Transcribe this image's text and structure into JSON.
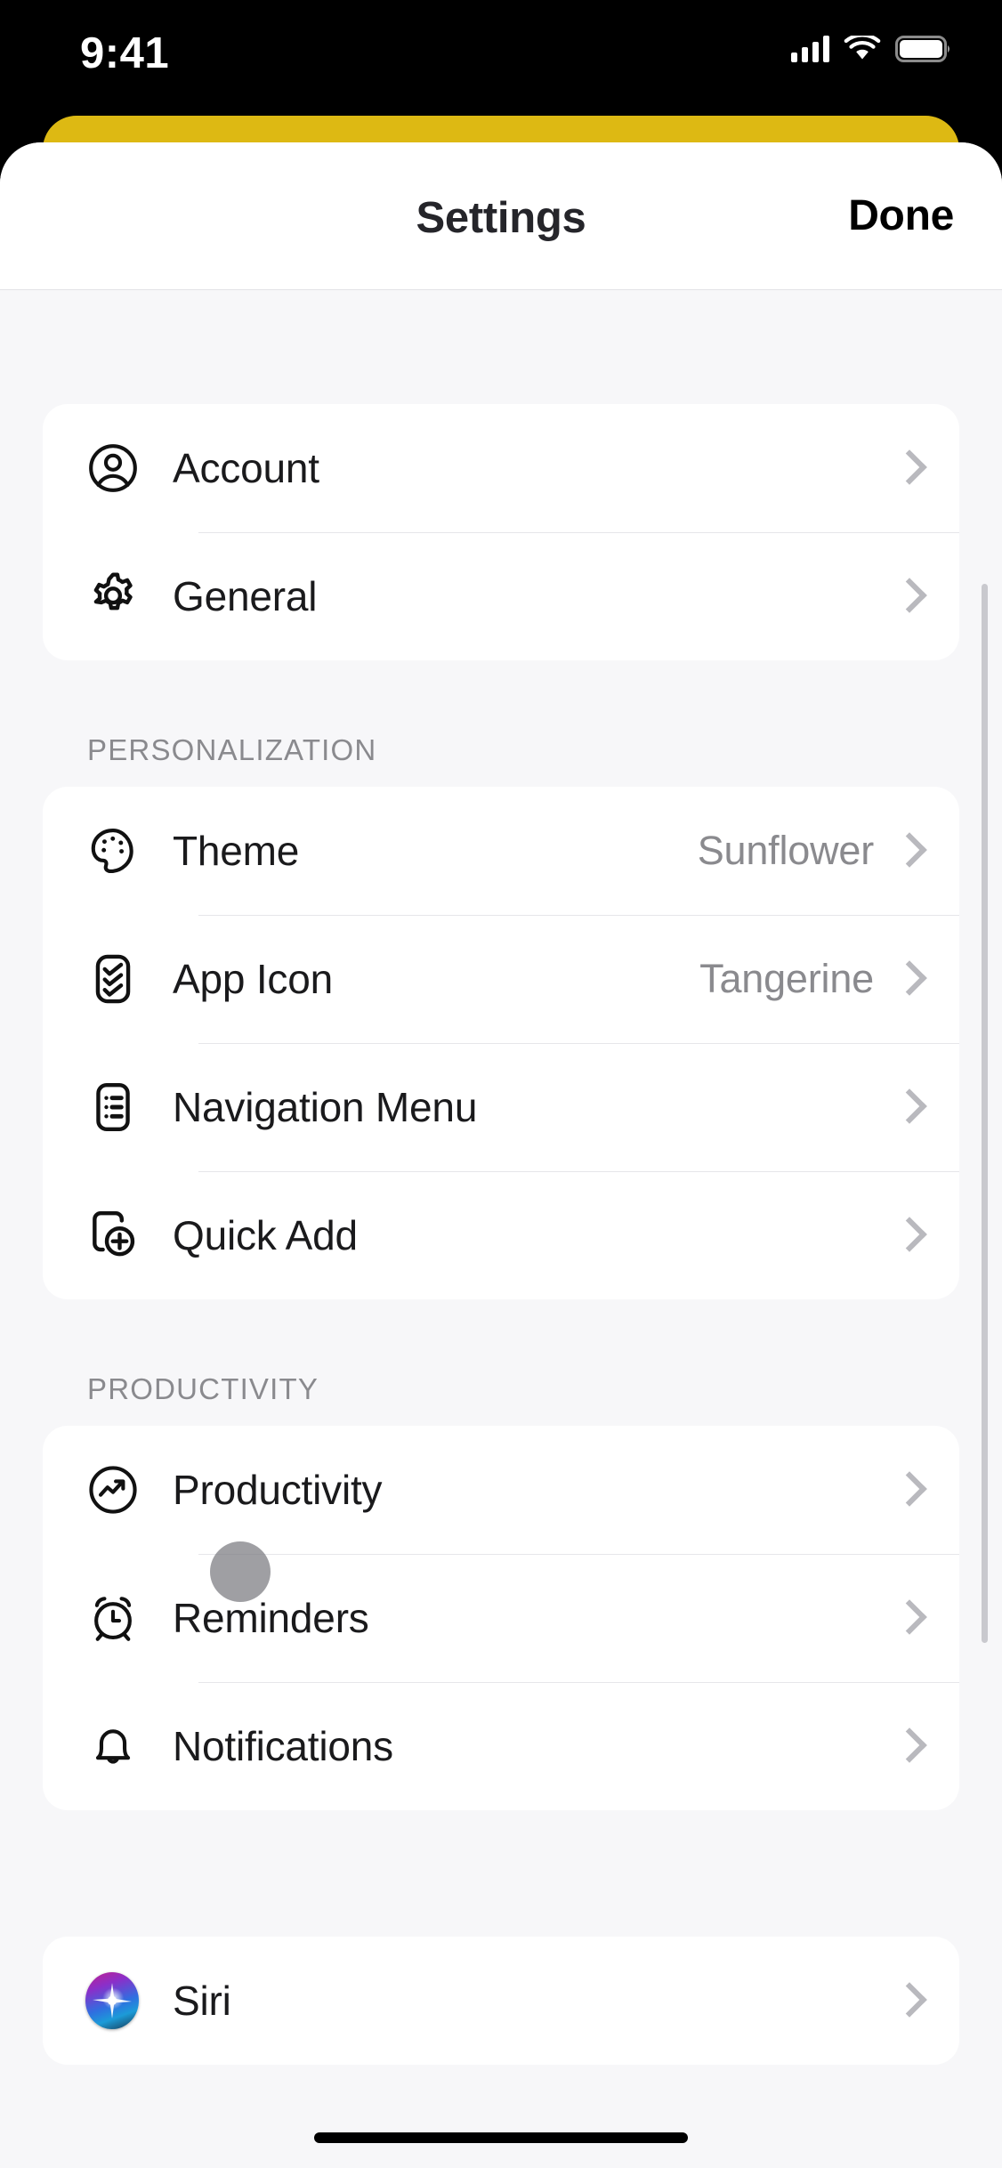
{
  "status_bar": {
    "time": "9:41",
    "cellular_icon": "cellular-bars-icon",
    "wifi_icon": "wifi-icon",
    "battery_icon": "battery-full-icon"
  },
  "nav": {
    "title": "Settings",
    "done_label": "Done"
  },
  "colors": {
    "sheet_behind": "#DDB913",
    "page_background": "#F7F7F9",
    "card_background": "#FFFFFF",
    "primary_text": "#1A1A1C",
    "secondary_text": "#8A8A8E",
    "chevron": "#B9B9BE",
    "separator": "#E6E6EA",
    "touch_indicator": "rgba(122,122,128,0.72)"
  },
  "sections": [
    {
      "header": "",
      "rows": [
        {
          "icon": "person-circle-icon",
          "label": "Account",
          "value": "",
          "chevron": true
        },
        {
          "icon": "gear-icon",
          "label": "General",
          "value": "",
          "chevron": true
        }
      ]
    },
    {
      "header": "PERSONALIZATION",
      "rows": [
        {
          "icon": "palette-icon",
          "label": "Theme",
          "value": "Sunflower",
          "chevron": true
        },
        {
          "icon": "app-icon-checklist-icon",
          "label": "App Icon",
          "value": "Tangerine",
          "chevron": true
        },
        {
          "icon": "list-menu-icon",
          "label": "Navigation Menu",
          "value": "",
          "chevron": true
        },
        {
          "icon": "document-plus-icon",
          "label": "Quick Add",
          "value": "",
          "chevron": true
        }
      ]
    },
    {
      "header": "PRODUCTIVITY",
      "rows": [
        {
          "icon": "chart-trending-up-circle-icon",
          "label": "Productivity",
          "value": "",
          "chevron": true
        },
        {
          "icon": "alarm-clock-icon",
          "label": "Reminders",
          "value": "",
          "chevron": true
        },
        {
          "icon": "bell-icon",
          "label": "Notifications",
          "value": "",
          "chevron": true
        }
      ]
    },
    {
      "header": "",
      "rows": [
        {
          "icon": "siri-icon",
          "label": "Siri",
          "value": "",
          "chevron": true
        }
      ]
    }
  ],
  "home_indicator": "home-indicator"
}
